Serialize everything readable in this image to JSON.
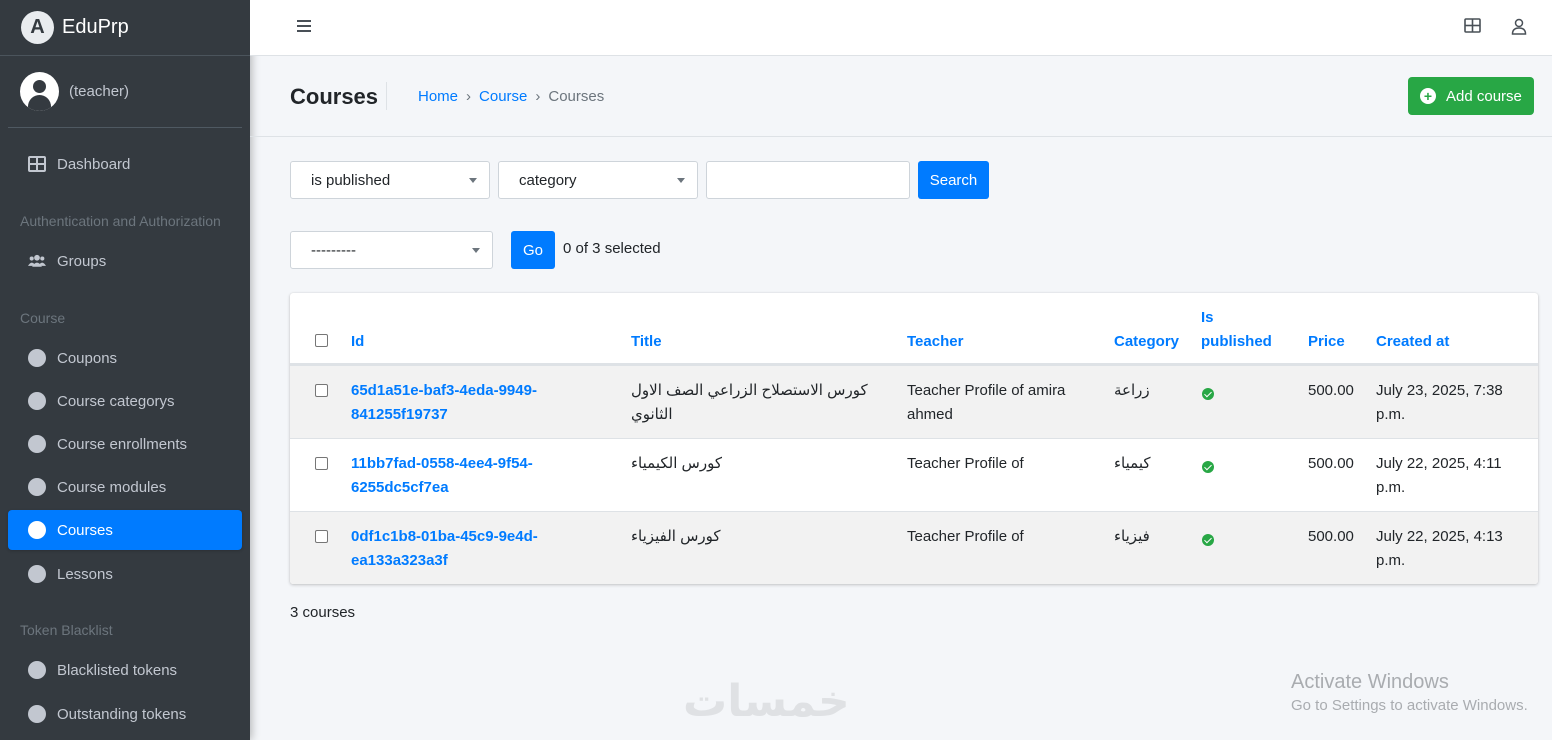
{
  "app": {
    "brand": "EduPrp"
  },
  "user": {
    "name": "(teacher)"
  },
  "sidebar": {
    "dashboard": "Dashboard",
    "section_auth": "Authentication and Authorization",
    "groups": "Groups",
    "section_course": "Course",
    "items": [
      "Coupons",
      "Course categorys",
      "Course enrollments",
      "Course modules",
      "Courses",
      "Lessons"
    ],
    "section_token": "Token Blacklist",
    "token_items": [
      "Blacklisted tokens",
      "Outstanding tokens"
    ]
  },
  "header": {
    "title": "Courses",
    "breadcrumb": [
      "Home",
      "Course",
      "Courses"
    ],
    "add_button": "Add course"
  },
  "filters": {
    "published_value": "is published",
    "category_value": "category",
    "search_button": "Search"
  },
  "actions": {
    "action_value": "---------",
    "go_button": "Go",
    "selected_text": "0 of 3 selected"
  },
  "table": {
    "columns": [
      "Id",
      "Title",
      "Teacher",
      "Category",
      "Is",
      "published",
      "Price",
      "Created at"
    ],
    "rows": [
      {
        "id_line1": "65d1a51e-baf3-4eda-9949-",
        "id_line2": "841255f19737",
        "title_line1": "كورس الاستصلاح الزراعي الصف الاول",
        "title_line2": "الثانوي",
        "teacher_line1": "Teacher Profile of amira",
        "teacher_line2": "ahmed",
        "category": "زراعة",
        "published": true,
        "price": "500.00",
        "created_line1": "July 23, 2025, 7:38",
        "created_line2": "p.m."
      },
      {
        "id_line1": "11bb7fad-0558-4ee4-9f54-",
        "id_line2": "6255dc5cf7ea",
        "title_line1": "كورس الكيمياء",
        "title_line2": "",
        "teacher_line1": "Teacher Profile of",
        "teacher_line2": "",
        "category": "كيمياء",
        "published": true,
        "price": "500.00",
        "created_line1": "July 22, 2025, 4:11",
        "created_line2": "p.m."
      },
      {
        "id_line1": "0df1c1b8-01ba-45c9-9e4d-",
        "id_line2": "ea133a323a3f",
        "title_line1": "كورس الفيزياء",
        "title_line2": "",
        "teacher_line1": "Teacher Profile of",
        "teacher_line2": "",
        "category": "فيزياء",
        "published": true,
        "price": "500.00",
        "created_line1": "July 22, 2025, 4:13",
        "created_line2": "p.m."
      }
    ]
  },
  "footer": {
    "count": "3 courses"
  },
  "overlay": {
    "watermark": "خمسات",
    "activate_title": "Activate Windows",
    "activate_sub": "Go to Settings to activate Windows."
  }
}
